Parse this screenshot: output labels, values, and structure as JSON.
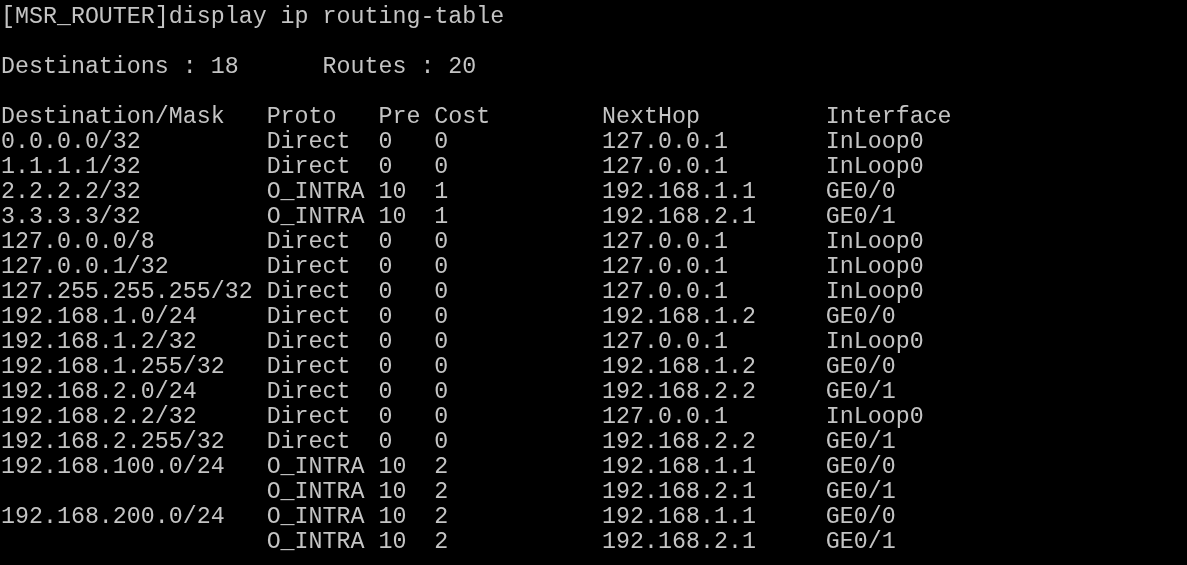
{
  "command_line": "[MSR_ROUTER]display ip routing-table",
  "summary": [
    "Destinations : 18",
    "Routes : 20"
  ],
  "table": {
    "columns": [
      "Destination/Mask",
      "Proto",
      "Pre",
      "Cost",
      "NextHop",
      "Interface"
    ],
    "rows": [
      {
        "destination": "0.0.0.0/32",
        "proto": "Direct",
        "pre": "0",
        "cost": "0",
        "nexthop": "127.0.0.1",
        "interface": "InLoop0"
      },
      {
        "destination": "1.1.1.1/32",
        "proto": "Direct",
        "pre": "0",
        "cost": "0",
        "nexthop": "127.0.0.1",
        "interface": "InLoop0"
      },
      {
        "destination": "2.2.2.2/32",
        "proto": "O_INTRA",
        "pre": "10",
        "cost": "1",
        "nexthop": "192.168.1.1",
        "interface": "GE0/0"
      },
      {
        "destination": "3.3.3.3/32",
        "proto": "O_INTRA",
        "pre": "10",
        "cost": "1",
        "nexthop": "192.168.2.1",
        "interface": "GE0/1"
      },
      {
        "destination": "127.0.0.0/8",
        "proto": "Direct",
        "pre": "0",
        "cost": "0",
        "nexthop": "127.0.0.1",
        "interface": "InLoop0"
      },
      {
        "destination": "127.0.0.1/32",
        "proto": "Direct",
        "pre": "0",
        "cost": "0",
        "nexthop": "127.0.0.1",
        "interface": "InLoop0"
      },
      {
        "destination": "127.255.255.255/32",
        "proto": "Direct",
        "pre": "0",
        "cost": "0",
        "nexthop": "127.0.0.1",
        "interface": "InLoop0"
      },
      {
        "destination": "192.168.1.0/24",
        "proto": "Direct",
        "pre": "0",
        "cost": "0",
        "nexthop": "192.168.1.2",
        "interface": "GE0/0"
      },
      {
        "destination": "192.168.1.2/32",
        "proto": "Direct",
        "pre": "0",
        "cost": "0",
        "nexthop": "127.0.0.1",
        "interface": "InLoop0"
      },
      {
        "destination": "192.168.1.255/32",
        "proto": "Direct",
        "pre": "0",
        "cost": "0",
        "nexthop": "192.168.1.2",
        "interface": "GE0/0"
      },
      {
        "destination": "192.168.2.0/24",
        "proto": "Direct",
        "pre": "0",
        "cost": "0",
        "nexthop": "192.168.2.2",
        "interface": "GE0/1"
      },
      {
        "destination": "192.168.2.2/32",
        "proto": "Direct",
        "pre": "0",
        "cost": "0",
        "nexthop": "127.0.0.1",
        "interface": "InLoop0"
      },
      {
        "destination": "192.168.2.255/32",
        "proto": "Direct",
        "pre": "0",
        "cost": "0",
        "nexthop": "192.168.2.2",
        "interface": "GE0/1"
      },
      {
        "destination": "192.168.100.0/24",
        "proto": "O_INTRA",
        "pre": "10",
        "cost": "2",
        "nexthop": "192.168.1.1",
        "interface": "GE0/0"
      },
      {
        "proto": "O_INTRA",
        "pre": "10",
        "cost": "2",
        "nexthop": "192.168.2.1",
        "interface": "GE0/1"
      },
      {
        "destination": "192.168.200.0/24",
        "proto": "O_INTRA",
        "pre": "10",
        "cost": "2",
        "nexthop": "192.168.1.1",
        "interface": "GE0/0"
      },
      {
        "proto": "O_INTRA",
        "pre": "10",
        "cost": "2",
        "nexthop": "192.168.2.1",
        "interface": "GE0/1"
      }
    ]
  }
}
